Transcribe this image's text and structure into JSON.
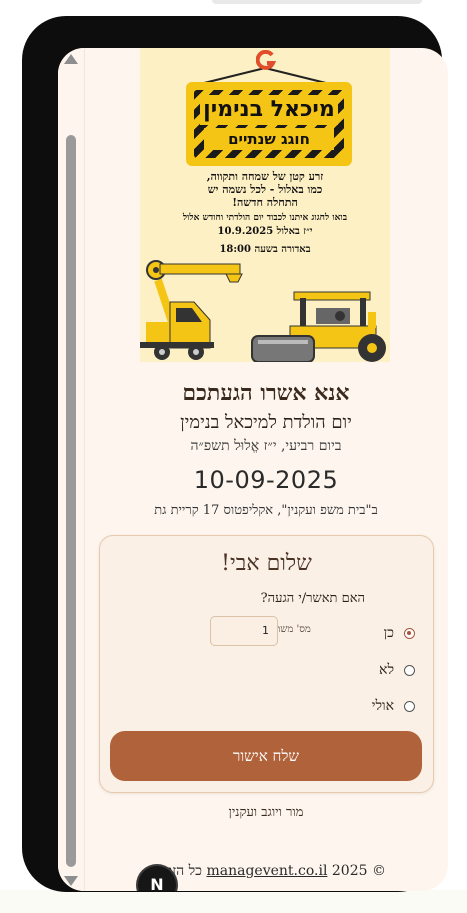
{
  "invitation": {
    "sign_title": "מיכאל בנימין",
    "sign_subtitle": "חוגג שנתיים",
    "body_lines": "זרע קטן של שמחה ותקווה,\nכמו באלול - לכל נשמה יש\nהתחלה חדשה!",
    "invite_line": "בואו לחגוג איתנו לכבוד יום הולדתי וחודש אלול",
    "date_line": "י״ז באלול 10.9.2025",
    "time_line": "באדורה בשעה 18:00"
  },
  "event": {
    "headline": "אנא אשרו הגעתכם",
    "subtitle": "יום הולדת למיכאל בנימין",
    "hebrew_date": "ביום רביעי, י״ז אֱלוּל תשפ״ה",
    "date": "10-09-2025",
    "location": "ב\"בית משפ ועקנין\", אקליפטוס 17 קריית גת"
  },
  "rsvp": {
    "greeting": "שלום אבי!",
    "question": "האם תאשר/י הגעה?",
    "options": [
      {
        "label": "כן",
        "selected": true
      },
      {
        "label": "לא",
        "selected": false
      },
      {
        "label": "אולי",
        "selected": false
      }
    ],
    "participants_label": "מס' משתתפים",
    "participants_value": "1",
    "submit_label": "שלח אישור"
  },
  "signoff": "מור ויוגב ועקנין",
  "footer": {
    "prefix": "© 2025 ",
    "link": "managevent.co.il",
    "suffix": " כל הזכויות"
  },
  "badge": "N",
  "colors": {
    "accent": "#b0633b",
    "page_bg": "#fdf5ee",
    "invite_bg": "#fdf0c4",
    "sign_yellow": "#f5c515"
  }
}
